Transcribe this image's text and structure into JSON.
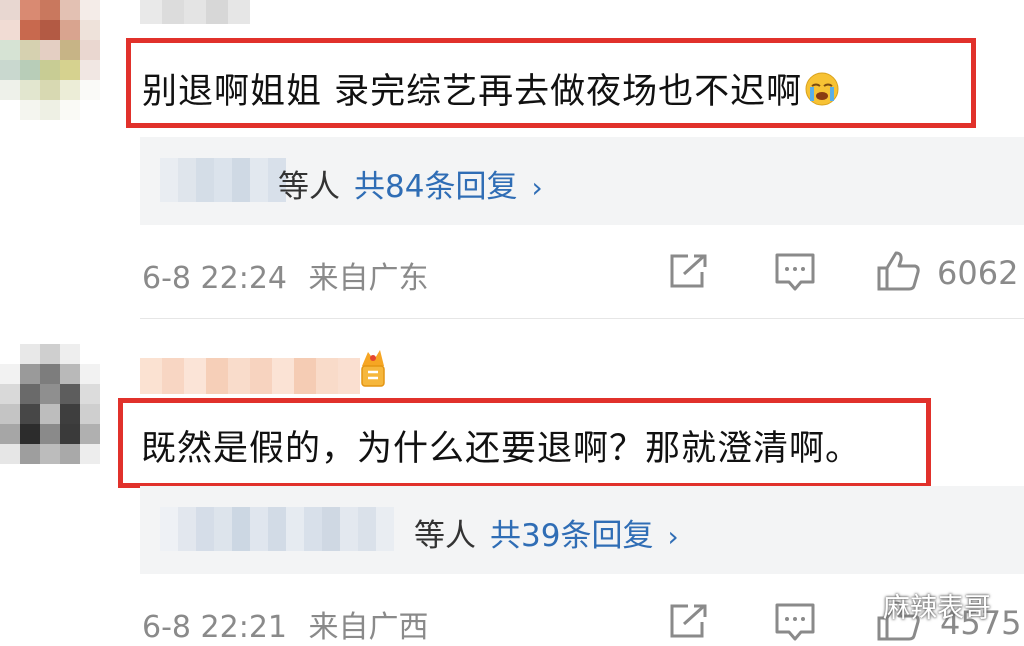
{
  "comments": [
    {
      "text": "别退啊姐姐 录完综艺再去做夜场也不迟啊",
      "emoji": "crying-face-emoji",
      "reply_who": "等人",
      "reply_count_label": "共84条回复",
      "reply_arrow": "›",
      "time": "6-8 22:24",
      "location": "来自广东",
      "likes": "6062"
    },
    {
      "text": "既然是假的，为什么还要退啊？那就澄清啊。",
      "reply_who": "等人",
      "reply_count_label": "共39条回复",
      "reply_arrow": "›",
      "time": "6-8 22:21",
      "location": "来自广西",
      "likes": "4575"
    }
  ],
  "watermark": "麻辣表哥",
  "colors": {
    "highlight": "#e1312b",
    "link": "#2f6db5",
    "meta": "#8a8a8a",
    "panel": "#f3f4f5"
  }
}
